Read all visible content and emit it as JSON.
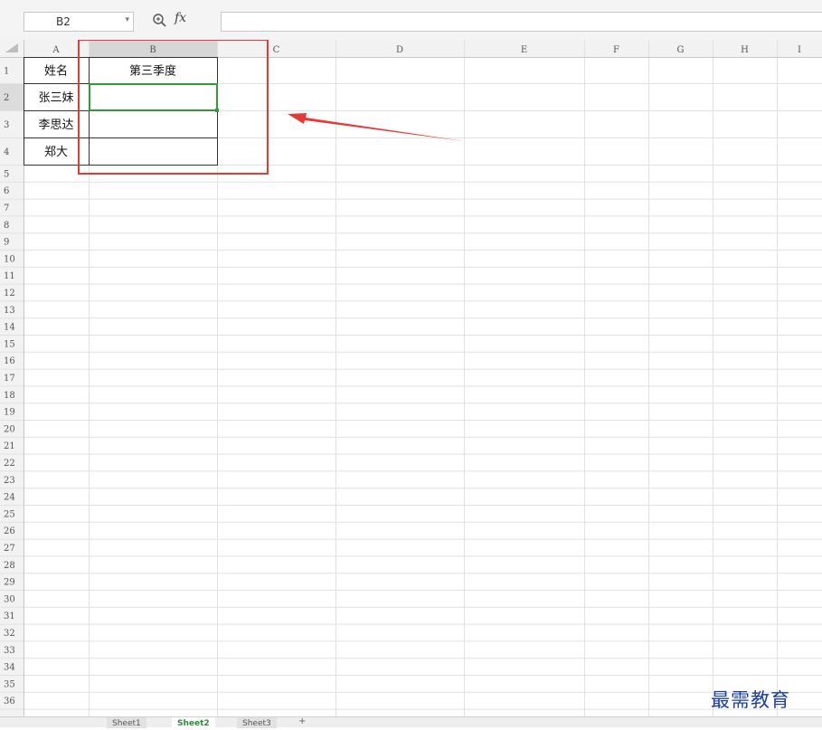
{
  "formula_bar": {
    "name_box": "B2",
    "fx": "fx",
    "value": ""
  },
  "columns": [
    "A",
    "B",
    "C",
    "D",
    "E",
    "F",
    "G",
    "H",
    "I"
  ],
  "rows": [
    "1",
    "2",
    "3",
    "4",
    "5",
    "6",
    "7",
    "8",
    "9",
    "10",
    "11",
    "12",
    "13",
    "14",
    "15",
    "16",
    "17",
    "18",
    "19",
    "20",
    "21",
    "22",
    "23",
    "24",
    "25",
    "26",
    "27",
    "28",
    "29",
    "30",
    "31",
    "32",
    "33",
    "34",
    "35",
    "36"
  ],
  "cells": {
    "A1": "姓名",
    "B1": "第三季度",
    "A2": "张三妹",
    "B2": "",
    "A3": "李思达",
    "B3": "",
    "A4": "郑大",
    "B4": ""
  },
  "selected_cell": "B2",
  "sheets": [
    {
      "label": "Sheet1",
      "active": false
    },
    {
      "label": "Sheet2",
      "active": true
    },
    {
      "label": "Sheet3",
      "active": false
    }
  ],
  "add_sheet": "+",
  "watermark": "最需教育",
  "colors": {
    "selection": "#2e9a3a",
    "annotation": "#e53935",
    "watermark": "#1a3fa5"
  }
}
